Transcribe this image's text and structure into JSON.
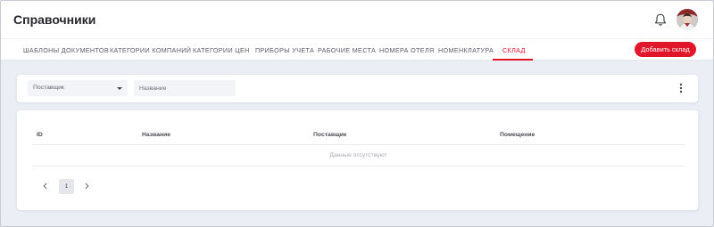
{
  "header": {
    "title": "Справочники",
    "icons": {
      "notifications": "bell-icon",
      "user": "avatar"
    }
  },
  "tabs": [
    {
      "label": "ШАБЛОНЫ ДОКУМЕНТОВ",
      "active": false
    },
    {
      "label": "КАТЕГОРИИ КОМПАНИЙ",
      "active": false
    },
    {
      "label": "КАТЕГОРИИ ЦЕН",
      "active": false
    },
    {
      "label": "ПРИБОРЫ УЧЕТА",
      "active": false
    },
    {
      "label": "РАБОЧИЕ МЕСТА",
      "active": false
    },
    {
      "label": "НОМЕРА ОТЕЛЯ",
      "active": false
    },
    {
      "label": "НОМЕНКЛАТУРА",
      "active": false
    },
    {
      "label": "СКЛАД",
      "active": true
    }
  ],
  "toolbar": {
    "add_label": "Добавить склад"
  },
  "filters": {
    "supplier_placeholder": "Поставщик",
    "name_placeholder": "Название"
  },
  "table": {
    "columns": [
      "ID",
      "Название",
      "Поставщик",
      "Помещение"
    ],
    "rows": [],
    "empty_text": "Данные отсутствуют"
  },
  "pagination": {
    "current_page": "1"
  },
  "colors": {
    "accent": "#e0162b",
    "background": "#eceef5",
    "card": "#ffffff",
    "input_bg": "#f3f4f7"
  }
}
